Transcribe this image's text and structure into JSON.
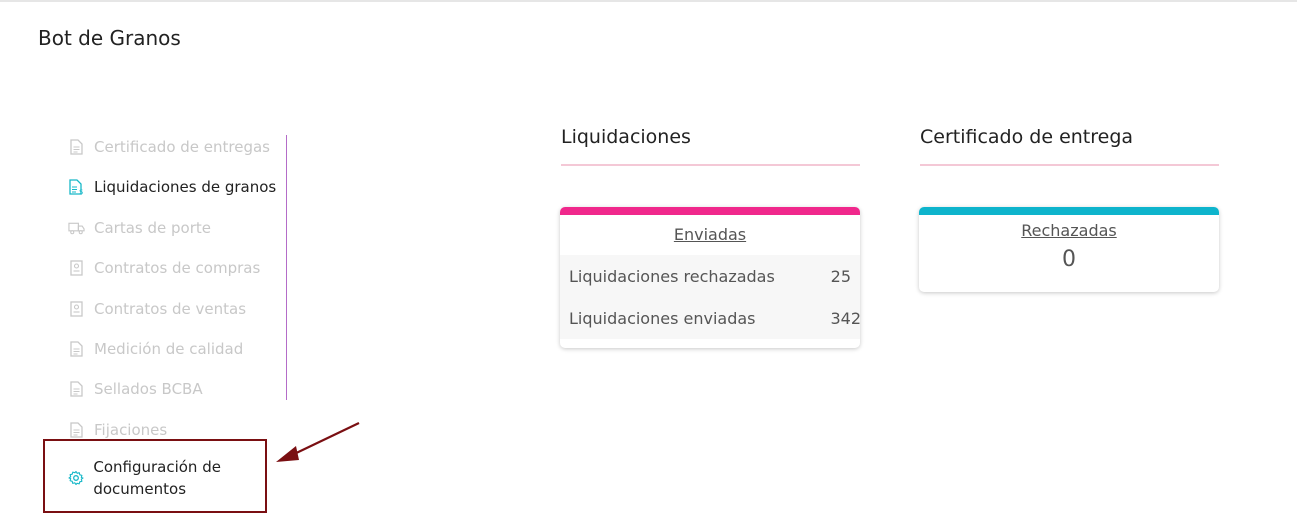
{
  "page": {
    "title": "Bot de Granos"
  },
  "sidebar": {
    "items": [
      {
        "label": "Certificado de entregas",
        "state": "disabled"
      },
      {
        "label": "Liquidaciones de granos",
        "state": "active"
      },
      {
        "label": "Cartas de porte",
        "state": "disabled"
      },
      {
        "label": "Contratos de compras",
        "state": "disabled"
      },
      {
        "label": "Contratos de ventas",
        "state": "disabled"
      },
      {
        "label": "Medición de calidad",
        "state": "disabled"
      },
      {
        "label": "Sellados BCBA",
        "state": "disabled"
      },
      {
        "label": "Fijaciones",
        "state": "disabled"
      },
      {
        "label": "Configuración de documentos",
        "state": "highlighted"
      }
    ]
  },
  "sections": {
    "liquidaciones": {
      "title": "Liquidaciones",
      "card_link": "Enviadas",
      "rows": [
        {
          "label": "Liquidaciones rechazadas",
          "value": "25"
        },
        {
          "label": "Liquidaciones enviadas",
          "value": "342"
        }
      ]
    },
    "certificado": {
      "title": "Certificado de entrega",
      "card_link": "Rechazadas",
      "value": "0"
    }
  },
  "colors": {
    "accent_pink": "#f0288c",
    "accent_cyan": "#0eb4cc",
    "sidebar_divider": "#b46cc8",
    "annotation": "#7a0f12"
  },
  "icons": {
    "document": "document-icon",
    "document_dollar": "document-dollar-icon",
    "truck": "truck-icon",
    "contract": "contract-icon",
    "gear": "gear-icon"
  }
}
